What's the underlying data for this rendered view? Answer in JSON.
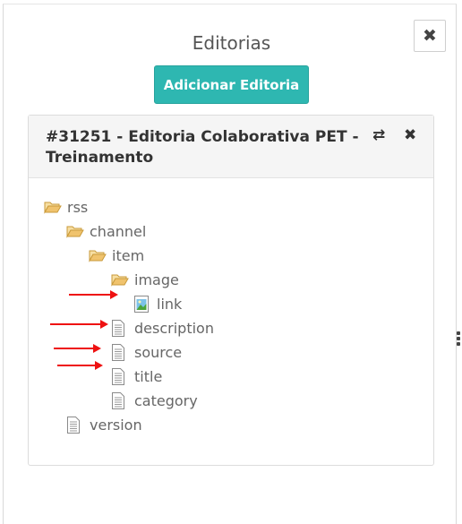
{
  "modal": {
    "title": "Editorias",
    "close_glyph": "✖",
    "add_button_label": "Adicionar Editoria"
  },
  "panel": {
    "title": "#31251 - Editoria Colaborativa PET - Treinamento",
    "swap_icon": "⇄",
    "remove_icon": "✖"
  },
  "tree": [
    {
      "label": "rss",
      "icon": "folder-open-icon",
      "depth": 0
    },
    {
      "label": "channel",
      "icon": "folder-open-icon",
      "depth": 1
    },
    {
      "label": "item",
      "icon": "folder-open-icon",
      "depth": 2
    },
    {
      "label": "image",
      "icon": "folder-open-icon",
      "depth": 3
    },
    {
      "label": "link",
      "icon": "image-file-icon",
      "depth": 4
    },
    {
      "label": "description",
      "icon": "text-file-icon",
      "depth": 3
    },
    {
      "label": "source",
      "icon": "text-file-icon",
      "depth": 3
    },
    {
      "label": "title",
      "icon": "text-file-icon",
      "depth": 3
    },
    {
      "label": "category",
      "icon": "text-file-icon",
      "depth": 3
    },
    {
      "label": "version",
      "icon": "text-file-icon",
      "depth": 1
    }
  ],
  "colors": {
    "accent": "#2eb7b1",
    "annotation_arrow": "#ee1111",
    "folder": "#f0c36d"
  }
}
